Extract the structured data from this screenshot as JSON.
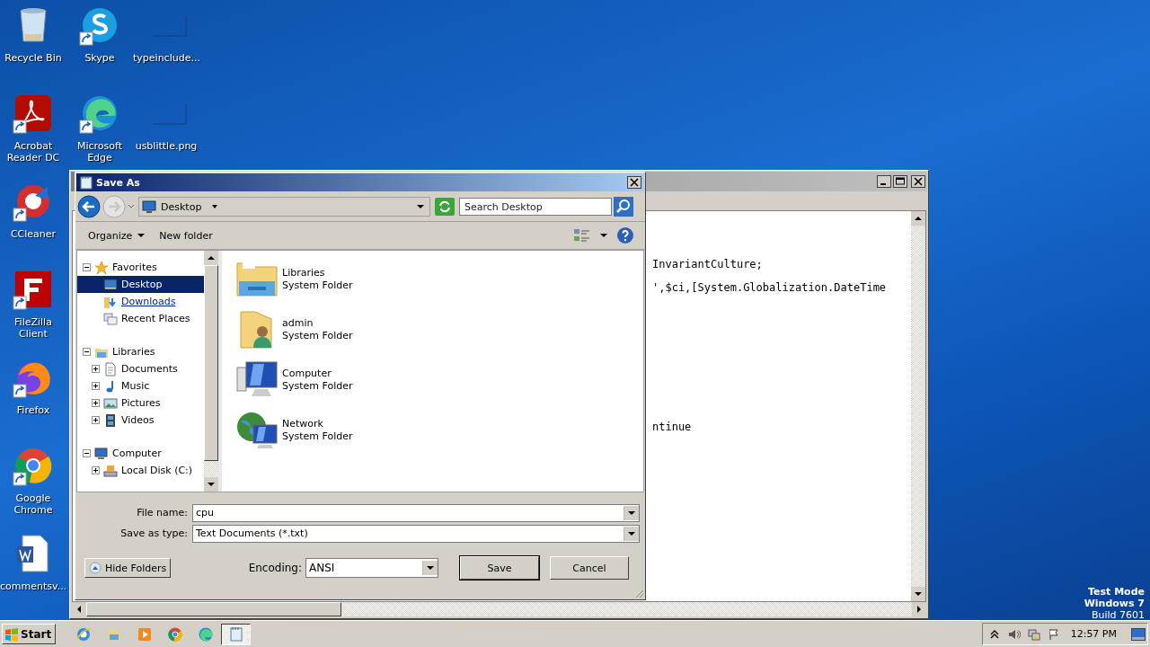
{
  "desktop_columns": [
    [
      {
        "label": "Recycle Bin",
        "kind": "recycle",
        "shortcut": false
      },
      {
        "label": "Acrobat Reader DC",
        "kind": "acrobat",
        "shortcut": true
      },
      {
        "label": "CCleaner",
        "kind": "ccleaner",
        "shortcut": true
      },
      {
        "label": "FileZilla Client",
        "kind": "filezilla",
        "shortcut": true
      },
      {
        "label": "Firefox",
        "kind": "firefox",
        "shortcut": true
      },
      {
        "label": "Google Chrome",
        "kind": "chrome",
        "shortcut": true
      },
      {
        "label": "commentsv...",
        "kind": "word",
        "shortcut": false
      }
    ],
    [
      {
        "label": "Skype",
        "kind": "skype",
        "shortcut": true
      },
      {
        "label": "Microsoft Edge",
        "kind": "edge",
        "shortcut": true
      }
    ],
    [
      {
        "label": "typeinclude...",
        "kind": "blank",
        "shortcut": false
      },
      {
        "label": "usblittle.png",
        "kind": "blank",
        "shortcut": false
      }
    ]
  ],
  "notepad": {
    "lines": [
      "InvariantCulture;",
      "',$ci,[System.Globalization.DateTime",
      "ntinue"
    ]
  },
  "dialog": {
    "title": "Save As",
    "address": "Desktop",
    "search": {
      "placeholder": "Search Desktop"
    },
    "toolbar": [
      {
        "label": "Organize",
        "menu": true
      },
      {
        "label": "New folder",
        "menu": false
      }
    ],
    "tree": [
      {
        "label": "Favorites",
        "kind": "star",
        "expanded": true,
        "selected": false,
        "children": [
          {
            "label": "Desktop",
            "kind": "desktop",
            "selected": true,
            "hovered": false
          },
          {
            "label": "Downloads",
            "kind": "downloads",
            "selected": false,
            "hovered": true
          },
          {
            "label": "Recent Places",
            "kind": "recent",
            "selected": false,
            "hovered": false
          }
        ]
      },
      {
        "label": "Libraries",
        "kind": "libraries",
        "expanded": true,
        "selected": false,
        "children": [
          {
            "label": "Documents",
            "kind": "documents",
            "selected": false,
            "hovered": false,
            "expanded": false
          },
          {
            "label": "Music",
            "kind": "music",
            "selected": false,
            "hovered": false,
            "expanded": false
          },
          {
            "label": "Pictures",
            "kind": "pictures",
            "selected": false,
            "hovered": false,
            "expanded": false
          },
          {
            "label": "Videos",
            "kind": "videos",
            "selected": false,
            "hovered": false,
            "expanded": false
          }
        ]
      },
      {
        "label": "Computer",
        "kind": "computer",
        "expanded": true,
        "selected": false,
        "children": [
          {
            "label": "Local Disk (C:)",
            "kind": "disk",
            "selected": false,
            "hovered": false,
            "expanded": false
          }
        ]
      }
    ],
    "items": [
      {
        "name": "Libraries",
        "type": "System Folder",
        "kind": "libraries"
      },
      {
        "name": "admin",
        "type": "System Folder",
        "kind": "user"
      },
      {
        "name": "Computer",
        "type": "System Folder",
        "kind": "computer"
      },
      {
        "name": "Network",
        "type": "System Folder",
        "kind": "network"
      }
    ],
    "file_name": {
      "label": "File name:",
      "value": "cpu"
    },
    "save_as_type": {
      "label": "Save as type:",
      "value": "Text Documents (*.txt)"
    },
    "hide_folders": "Hide Folders",
    "encoding": {
      "label": "Encoding:",
      "value": "ANSI"
    },
    "buttons": [
      "Save",
      "Cancel"
    ]
  },
  "system_text": [
    "Test Mode",
    "Windows 7",
    "Build 7601"
  ],
  "taskbar": {
    "start": "Start",
    "apps": [
      {
        "kind": "ie",
        "active": false
      },
      {
        "kind": "explorer",
        "active": false
      },
      {
        "kind": "media",
        "active": false
      },
      {
        "kind": "chrome",
        "active": false
      },
      {
        "kind": "edge",
        "active": false
      },
      {
        "kind": "notepad",
        "active": true
      }
    ],
    "clock": "12:57 PM"
  }
}
